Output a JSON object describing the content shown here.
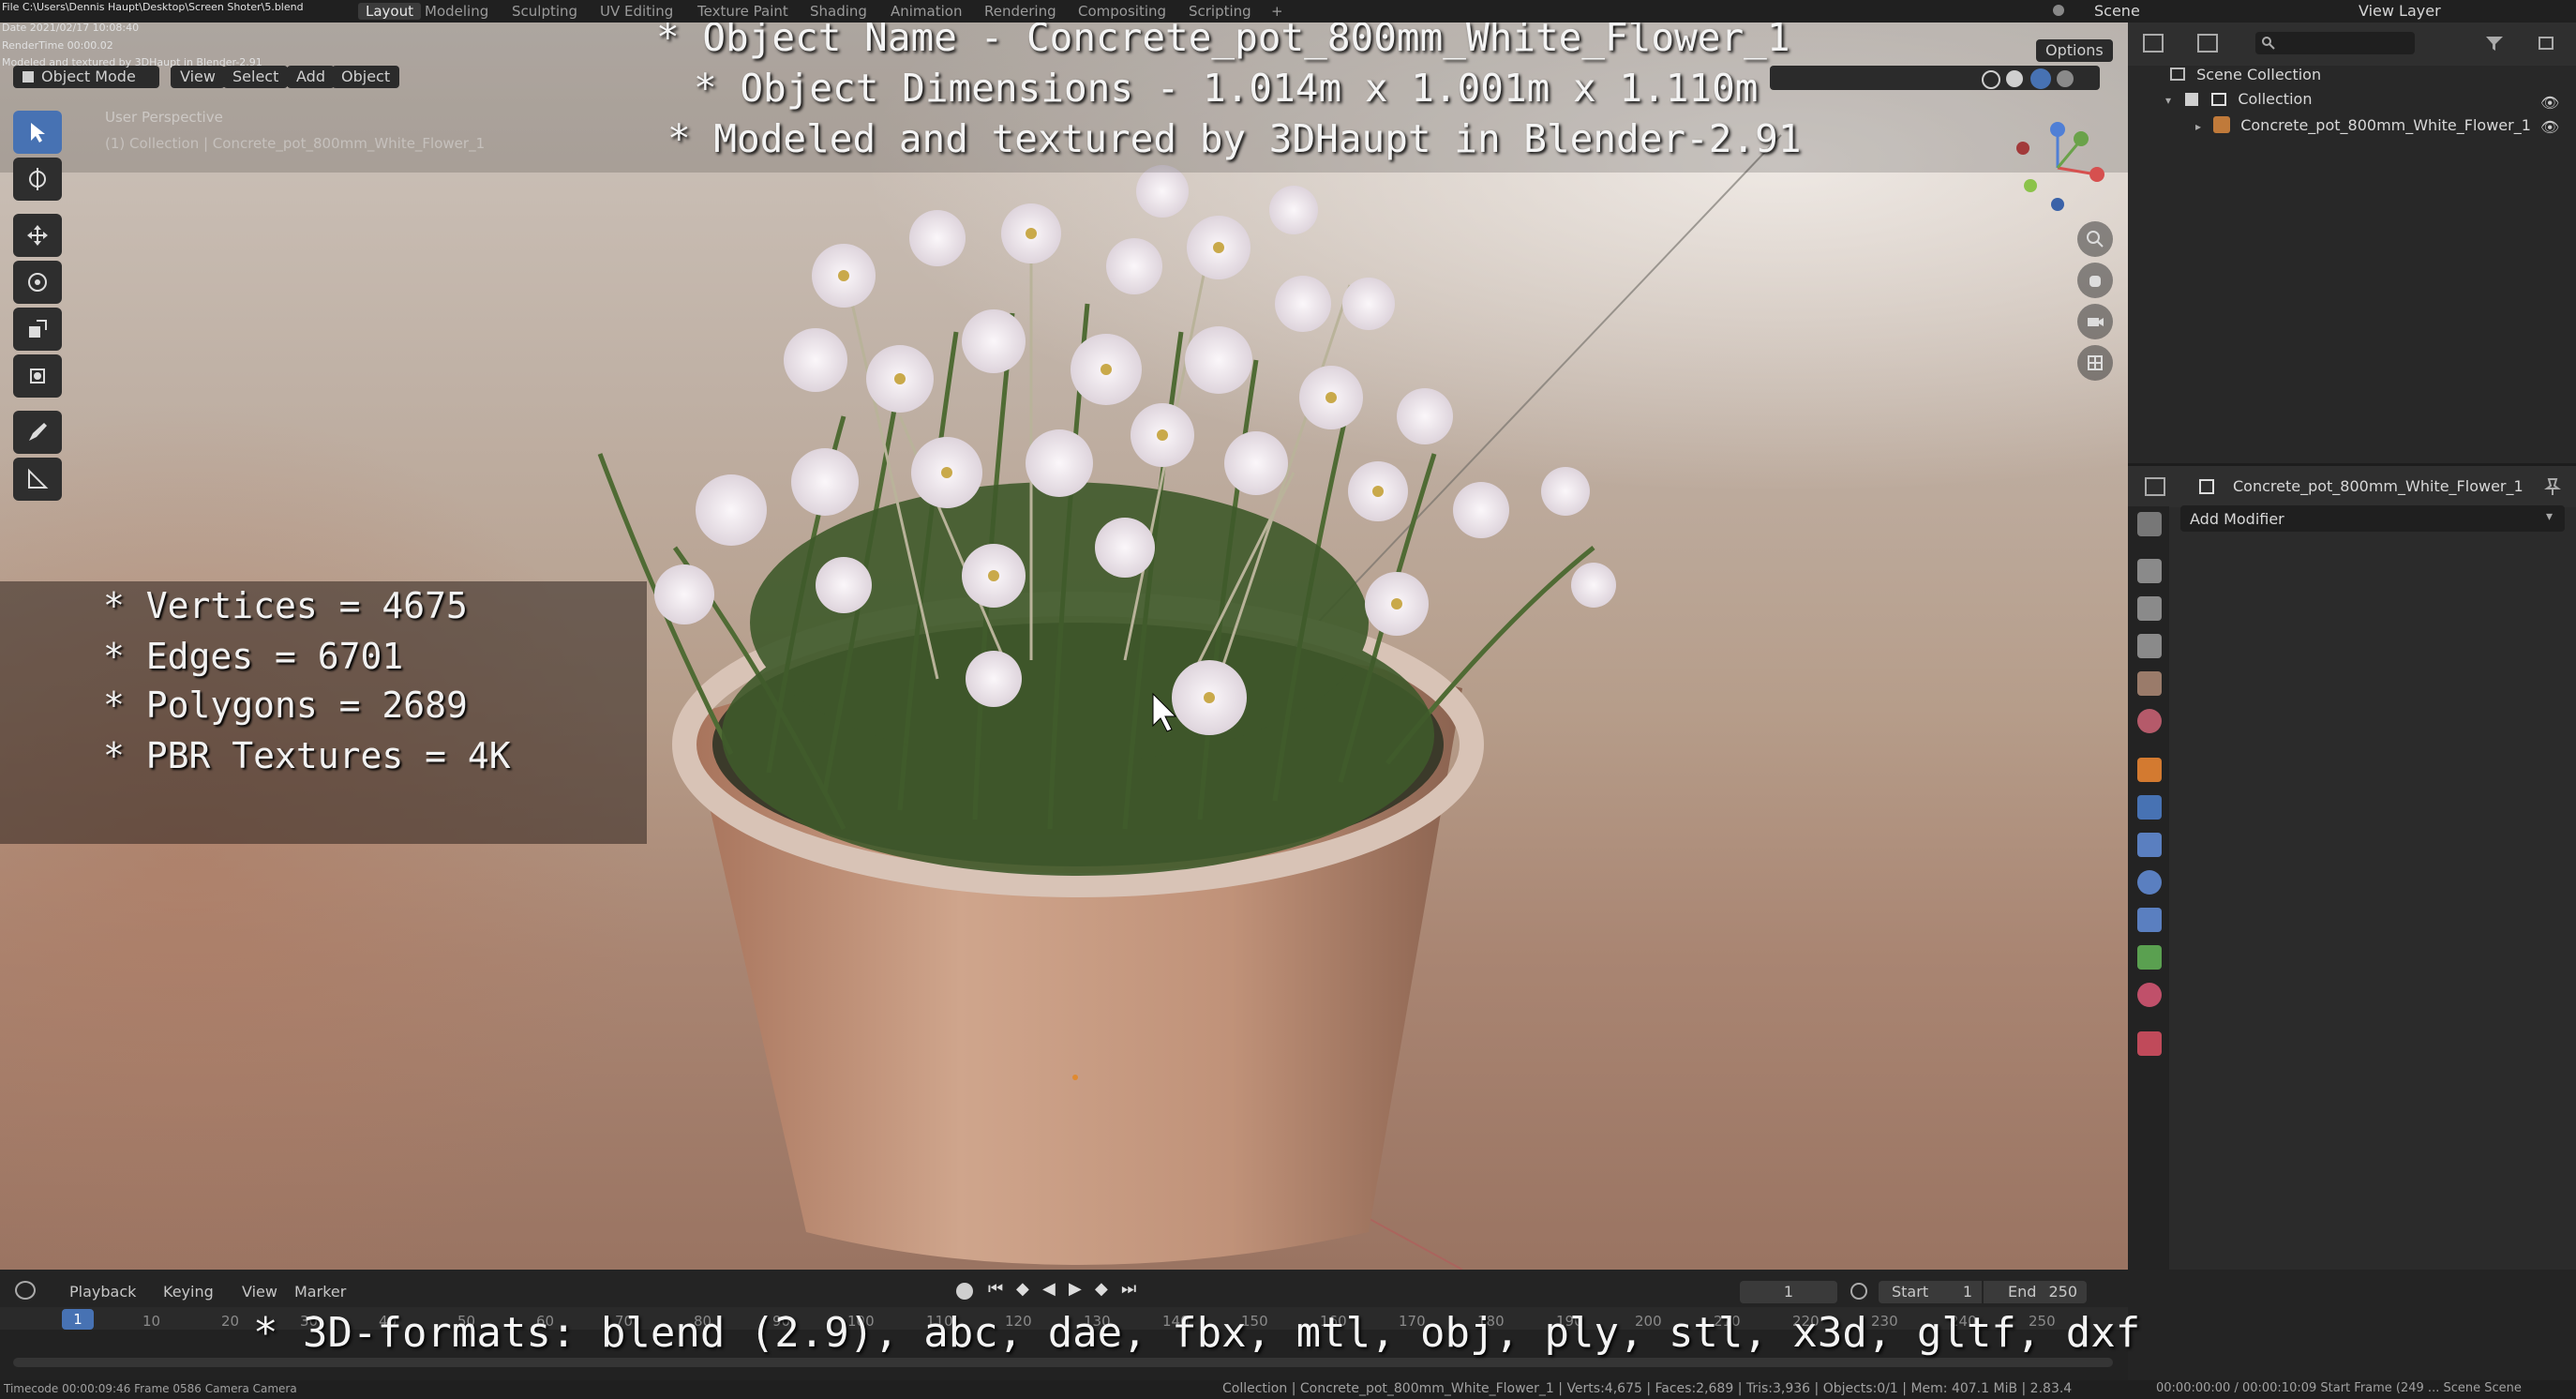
{
  "topbar": {
    "file_line": "File C:\\Users\\Dennis Haupt\\Desktop\\Screen Shoter\\5.blend",
    "date_line": "Date 2021/02/17 10:08:40",
    "render_line": "RenderTime 00:00.02",
    "modeled_line": "Modeled and textured by 3DHaupt in Blender-2.91",
    "workspaces": [
      "Layout",
      "Modeling",
      "Sculpting",
      "UV Editing",
      "Texture Paint",
      "Shading",
      "Animation",
      "Rendering",
      "Compositing",
      "Scripting"
    ],
    "add_tab": "+",
    "scene_label": "Scene",
    "view_layer_label": "View Layer"
  },
  "viewport": {
    "mode": "Object Mode",
    "menus": [
      "View",
      "Select",
      "Add",
      "Object"
    ],
    "options_label": "Options",
    "perspective_label": "User Perspective",
    "collection_label": "(1) Collection | Concrete_pot_800mm_White_Flower_1"
  },
  "overlay": {
    "line1": "* Object Name - Concrete_pot_800mm_White_Flower_1",
    "line2": "* Object Dimensions -  1.014m x 1.001m x 1.110m",
    "line3": "* Modeled and textured by 3DHaupt in Blender-2.91",
    "stats": [
      "* Vertices = 4675",
      "* Edges = 6701",
      "* Polygons = 2689",
      "* PBR Textures = 4K"
    ],
    "formats": "* 3D-formats: blend (2.9), abc, dae, fbx, mtl, obj, ply, stl, x3d, gltf, dxf"
  },
  "outliner": {
    "scene_collection": "Scene Collection",
    "collection": "Collection",
    "object": "Concrete_pot_800mm_White_Flower_1"
  },
  "properties": {
    "object_name": "Concrete_pot_800mm_White_Flower_1",
    "add_modifier": "Add Modifier"
  },
  "timeline": {
    "menus": [
      "Playback",
      "Keying",
      "View",
      "Marker"
    ],
    "current_frame": "1",
    "start_label": "Start",
    "start_value": "1",
    "end_label": "End",
    "end_value": "250",
    "ruler": [
      "1",
      "10",
      "20",
      "30",
      "40",
      "50",
      "60",
      "70",
      "80",
      "90",
      "100",
      "110",
      "120",
      "130",
      "140",
      "150",
      "160",
      "170",
      "180",
      "190",
      "200",
      "210",
      "220",
      "230",
      "240",
      "250"
    ]
  },
  "statusbar": {
    "left": "Timecode 00:00:09:46   Frame 0586   Camera Camera",
    "center": "Collection | Concrete_pot_800mm_White_Flower_1 | Verts:4,675 | Faces:2,689 | Tris:3,936 | Objects:0/1 | Mem: 407.1 MiB | 2.83.4",
    "right": "00:00:00:00 / 00:00:10:09     Start Frame (249 ...   Scene Scene"
  },
  "colors": {
    "active_blue": "#4772b3",
    "panel_bg": "#2b2b2b",
    "flower": "#efe9ef",
    "pot": "#c9a38c"
  }
}
